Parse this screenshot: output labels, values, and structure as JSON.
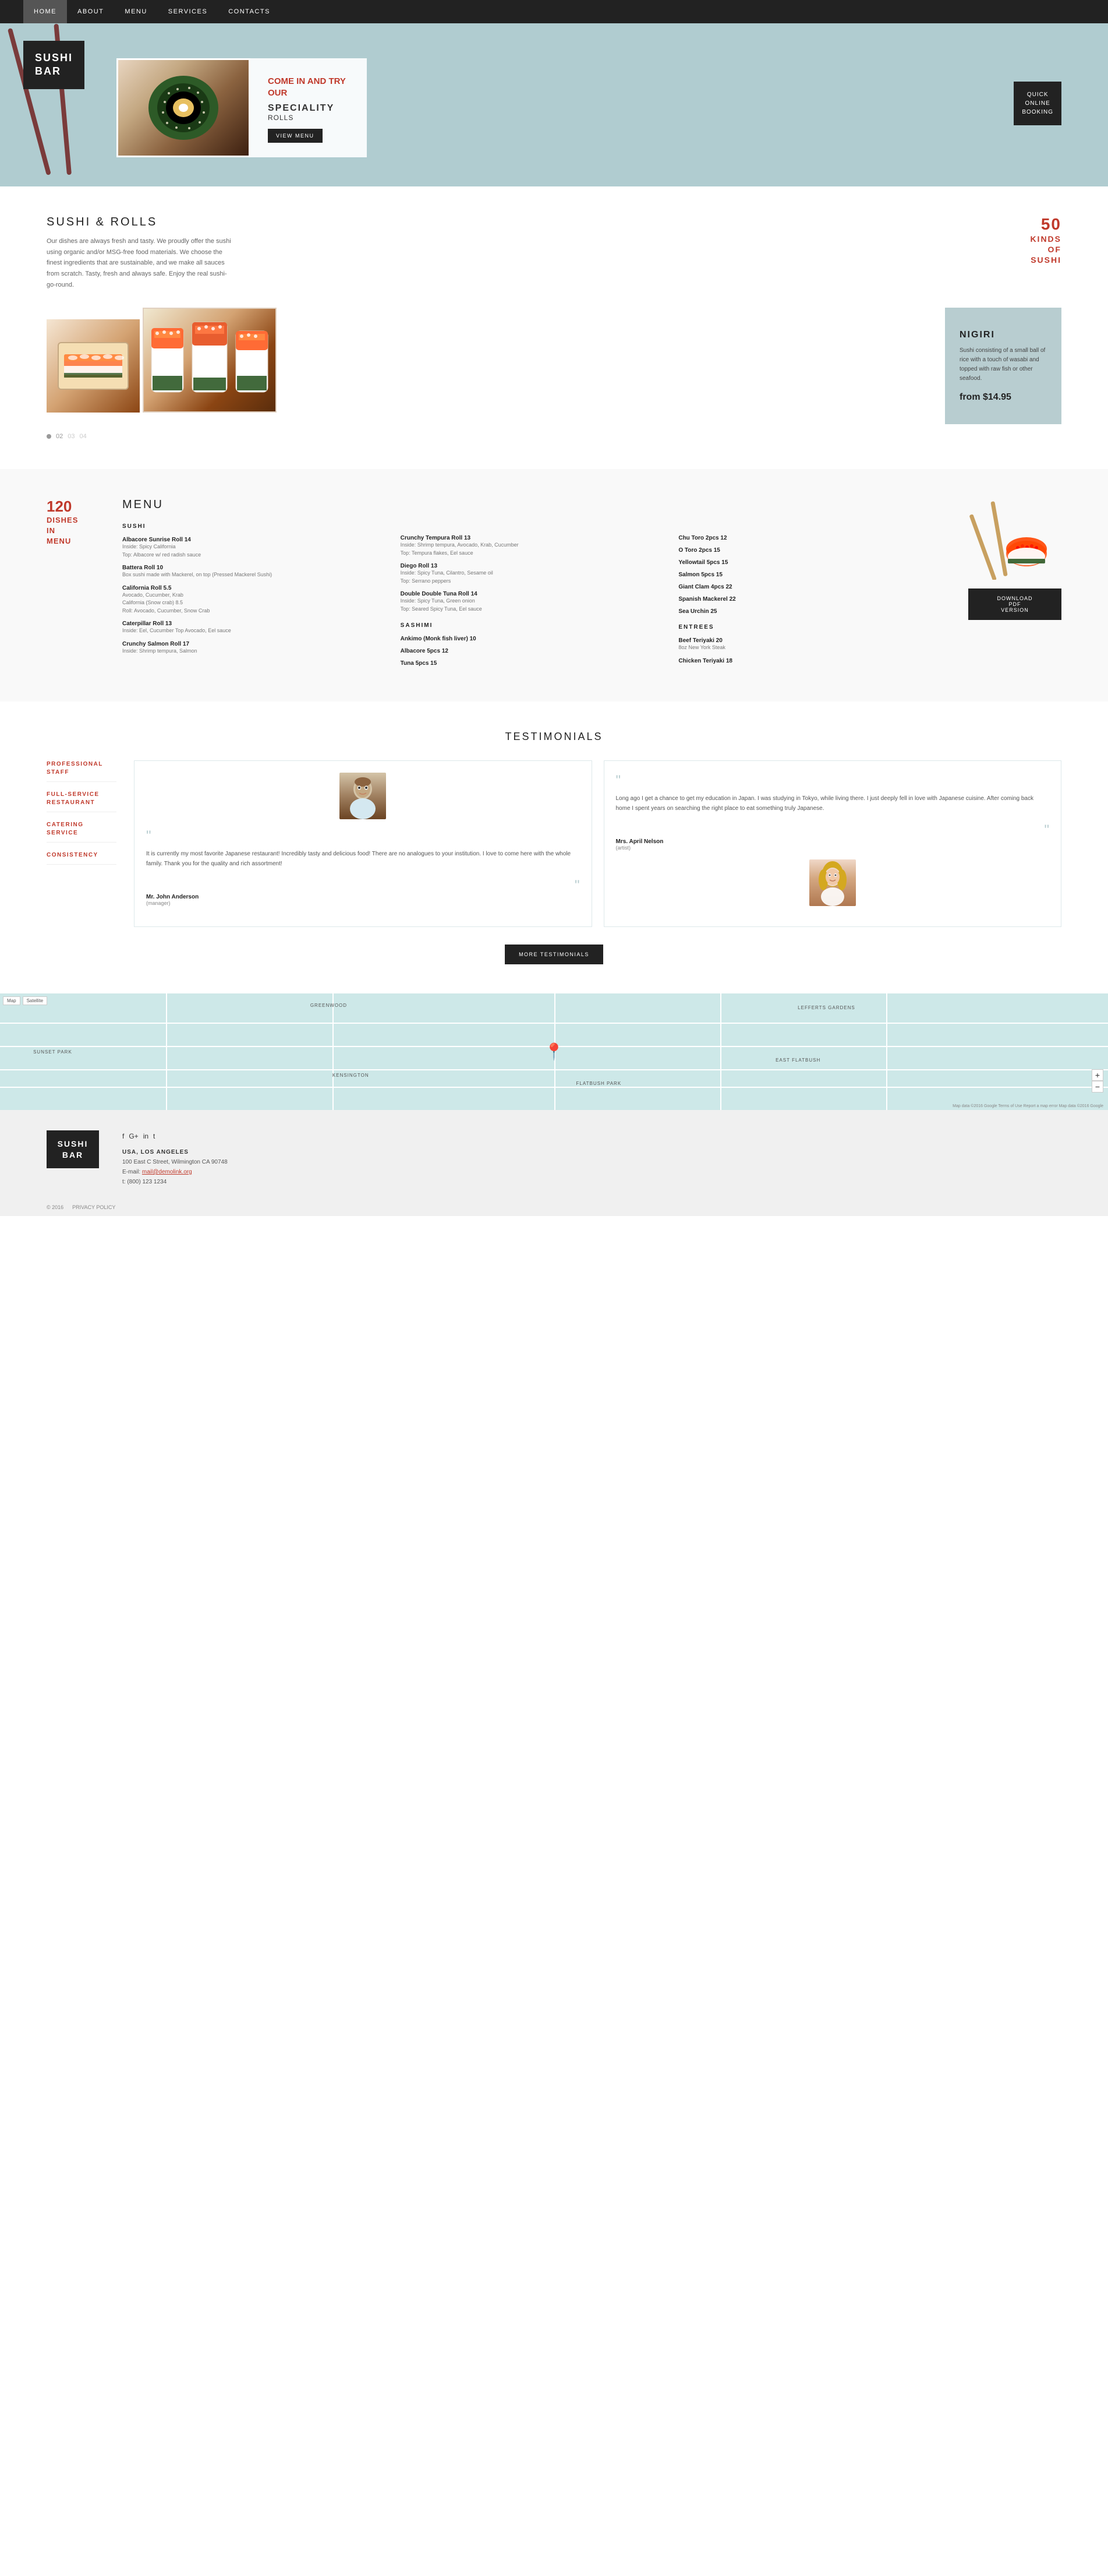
{
  "nav": {
    "links": [
      "HOME",
      "ABOUT",
      "MENU",
      "SERVICES",
      "CONTACTS"
    ],
    "active": "HOME"
  },
  "hero": {
    "logo_line1": "SUSHI",
    "logo_line2": "BAR",
    "tagline": "COME IN AND TRY OUR",
    "speciality": "SPECIALITY",
    "rolls": "ROLLS",
    "view_menu_btn": "VIEW MENU",
    "booking_line1": "QUICK",
    "booking_line2": "ONLINE",
    "booking_line3": "BOOKING"
  },
  "sushi_rolls": {
    "title": "SUSHI & ROLLS",
    "description": "Our dishes are always fresh and tasty. We proudly offer the sushi using organic and/or MSG-free food materials. We choose the finest ingredients that are sustainable, and we make all sauces from scratch. Tasty, fresh and always safe. Enjoy the real sushi-go-round.",
    "stat_number": "50",
    "stat_label": "KINDS\nOF\nSUSHI",
    "dots": [
      "01",
      "02",
      "03",
      "04"
    ],
    "active_dot": 0,
    "nigiri": {
      "title": "NIGIRI",
      "description": "Sushi consisting of a small ball of rice with a touch of wasabi and topped with raw fish or other seafood.",
      "price": "from $14.95"
    }
  },
  "menu": {
    "stat_number": "120",
    "stat_label": "DISHES\nIN\nMENU",
    "title": "MENU",
    "categories": [
      {
        "name": "SUSHI",
        "items": [
          {
            "name": "Albacore Sunrise Roll 14",
            "desc": "Inside: Spicy California\nTop: Albacore w/ red radish sauce"
          },
          {
            "name": "Battera Roll 10",
            "desc": "Box sushi made with Mackerel, on top (Pressed Mackerel Sushi)"
          },
          {
            "name": "California Roll 5.5",
            "desc": "Avocado, Cucumber, Krab\nCalifornia (Snow crab) 8.5\nRoll: Avocado, Cucumber, Snow Crab"
          },
          {
            "name": "Caterpillar Roll 13",
            "desc": "Inside: Eel, Cucumber Top Avocado, Eel sauce"
          },
          {
            "name": "Crunchy Salmon Roll 17",
            "desc": "Inside: Shrimp tempura, Salmon"
          }
        ]
      }
    ],
    "col2_items": [
      {
        "name": "Crunchy Tempura Roll 13",
        "desc": "Inside: Shrimp tempura, Avocado, Krab, Cucumber\nTop: Tempura flakes, Eel sauce"
      },
      {
        "name": "Diego Roll 13",
        "desc": "Inside: Spicy Tuna, Cilantro,\nSesame oil\nTop: Serrano peppers"
      },
      {
        "name": "Double Double Tuna Roll 14",
        "desc": "Inside: Spicy Tuna, Green onion\nTop: Seared Spicy Tuna, Eel sauce"
      }
    ],
    "col2_sashimi": {
      "name": "SASHIMI",
      "items": [
        {
          "name": "Ankimo (Monk fish liver) 10"
        },
        {
          "name": "Albacore 5pcs 12"
        },
        {
          "name": "Tuna 5pcs 15"
        }
      ]
    },
    "col3_items": [
      {
        "name": "Chu Toro 2pcs 12"
      },
      {
        "name": "O Toro 2pcs 15"
      },
      {
        "name": "Yellowtail 5pcs 15"
      },
      {
        "name": "Salmon 5pcs 15"
      },
      {
        "name": "Giant Clam 4pcs 22"
      },
      {
        "name": "Spanish Mackerel 22"
      },
      {
        "name": "Sea Urchin 25"
      }
    ],
    "entrees": {
      "name": "ENTREES",
      "items": [
        {
          "name": "Beef Teriyaki 20",
          "desc": "8oz New York Steak"
        },
        {
          "name": "Chicken Teriyaki 18"
        }
      ]
    },
    "download_btn": "DOWNLOAD\nPDF\nVERSION"
  },
  "testimonials": {
    "title": "TESTIMONIALS",
    "features": [
      "PROFESSIONAL\nSTAFF",
      "FULL-SERVICE\nRESTAURANT",
      "CATERING\nSERVICE",
      "CONSISTENCY"
    ],
    "cards": [
      {
        "text": "It is currently my most favorite Japanese restaurant! Incredibly tasty and delicious food! There are no analogues to your institution. I love to come here with the whole family. Thank you for the quality and rich assortment!",
        "name": "Mr. John Anderson",
        "role": "(manager)"
      },
      {
        "text": "Long ago I get a chance to get my education in Japan. I was studying in Tokyo, while living there. I just deeply fell in love with Japanese cuisine. After coming back home I spent years on searching the right place to eat something truly Japanese.",
        "name": "Mrs. April Nelson",
        "role": "(artist)"
      }
    ],
    "more_btn": "MORE TESTIMONIALS"
  },
  "map": {
    "labels": [
      "GREENWOOD",
      "SUNSET PARK",
      "KENSINGTON",
      "FLATBUSH PARK",
      "EAST FLATBUSH",
      "LEFFERTS GARDENS"
    ],
    "attribution": "Map data ©2016 Google  Terms of Use  Report a map error  Map data ©2016 Google",
    "ctrl_map": "Map",
    "ctrl_satellite": "Satellite"
  },
  "footer": {
    "logo_line1": "SUSHI",
    "logo_line2": "BAR",
    "address_title": "USA, LOS ANGELES",
    "address": "100 East C Street, Wilmington CA 90748",
    "email_label": "E-mail:",
    "email": "mail@demolink.org",
    "phone_label": "t:",
    "phone": "(800) 123 1234",
    "social_icons": [
      "f",
      "G+",
      "in",
      "t"
    ],
    "copyright": "© 2016",
    "privacy": "PRIVACY POLICY"
  }
}
